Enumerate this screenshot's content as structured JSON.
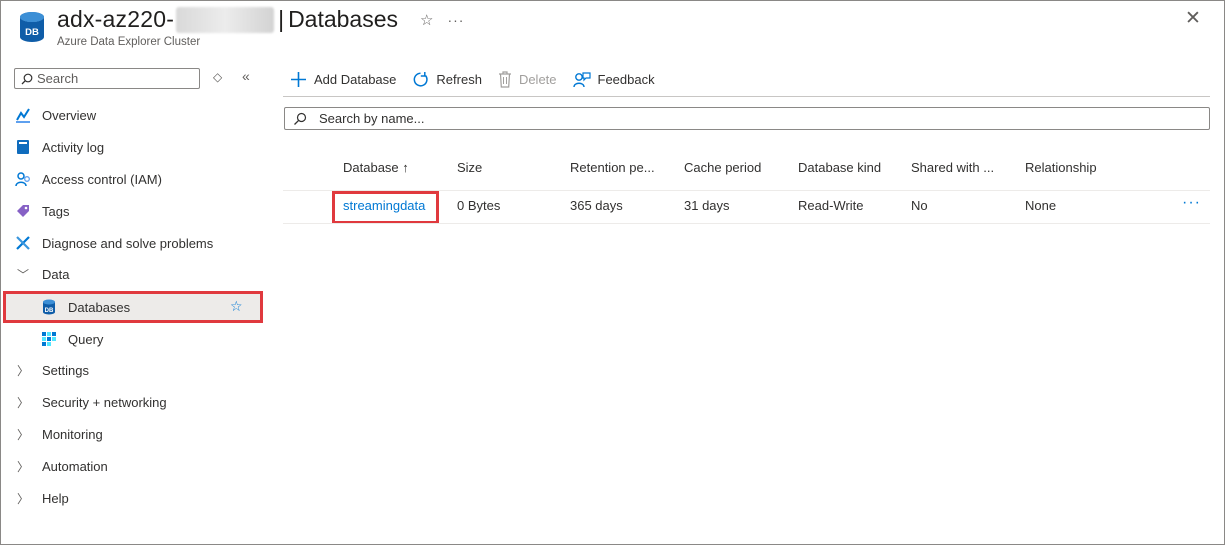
{
  "header": {
    "resource_name": "adx-az220-",
    "separator": "|",
    "page_title": "Databases",
    "subtitle": "Azure Data Explorer Cluster",
    "icon_text": "DB",
    "favorite_glyph": "☆",
    "more_glyph": "···",
    "close_glyph": "✕"
  },
  "nav": {
    "search_placeholder": "Search",
    "items": [
      {
        "label": "Overview",
        "icon": "overview-icon"
      },
      {
        "label": "Activity log",
        "icon": "activity-log-icon"
      },
      {
        "label": "Access control (IAM)",
        "icon": "iam-icon"
      },
      {
        "label": "Tags",
        "icon": "tag-icon"
      },
      {
        "label": "Diagnose and solve problems",
        "icon": "wrench-icon"
      },
      {
        "label": "Data",
        "expanded": true
      },
      {
        "label": "Databases",
        "icon": "database-icon",
        "selected": true
      },
      {
        "label": "Query",
        "icon": "query-icon"
      },
      {
        "label": "Settings",
        "expanded": false
      },
      {
        "label": "Security + networking",
        "expanded": false
      },
      {
        "label": "Monitoring",
        "expanded": false
      },
      {
        "label": "Automation",
        "expanded": false
      },
      {
        "label": "Help",
        "expanded": false
      }
    ]
  },
  "toolbar": {
    "add_label": "Add Database",
    "refresh_label": "Refresh",
    "delete_label": "Delete",
    "feedback_label": "Feedback"
  },
  "filter": {
    "placeholder": "Search by name..."
  },
  "table": {
    "columns": [
      "Database ↑",
      "Size",
      "Retention pe...",
      "Cache period",
      "Database kind",
      "Shared with ...",
      "Relationship"
    ],
    "rows": [
      {
        "database": "streamingdata",
        "size": "0 Bytes",
        "retention": "365 days",
        "cache": "31 days",
        "kind": "Read-Write",
        "shared": "No",
        "relationship": "None"
      }
    ],
    "row_more": "···"
  },
  "colors": {
    "accent": "#0078d4",
    "highlight": "#e0393e"
  }
}
